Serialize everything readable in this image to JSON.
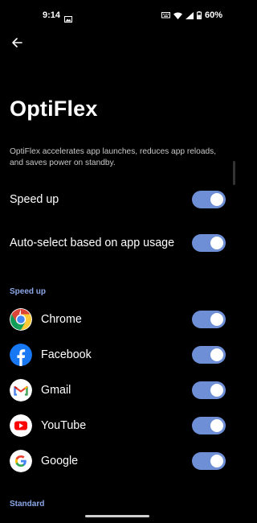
{
  "status_bar": {
    "time": "9:14",
    "battery": "60%"
  },
  "page": {
    "title": "OptiFlex",
    "description": "OptiFlex accelerates app launches, reduces app reloads, and saves power on standby."
  },
  "main_toggles": [
    {
      "label": "Speed up",
      "on": true
    },
    {
      "label": "Auto-select based on app usage",
      "on": true
    }
  ],
  "sections": {
    "speed_up": "Speed up",
    "standard": "Standard"
  },
  "apps": [
    {
      "label": "Chrome",
      "icon": "chrome-icon",
      "on": true
    },
    {
      "label": "Facebook",
      "icon": "facebook-icon",
      "on": true
    },
    {
      "label": "Gmail",
      "icon": "gmail-icon",
      "on": true
    },
    {
      "label": "YouTube",
      "icon": "youtube-icon",
      "on": true
    },
    {
      "label": "Google",
      "icon": "google-icon",
      "on": true
    }
  ],
  "colors": {
    "background": "#000000",
    "accent": "#6e8fd6",
    "section_header": "#8aa7e8"
  }
}
